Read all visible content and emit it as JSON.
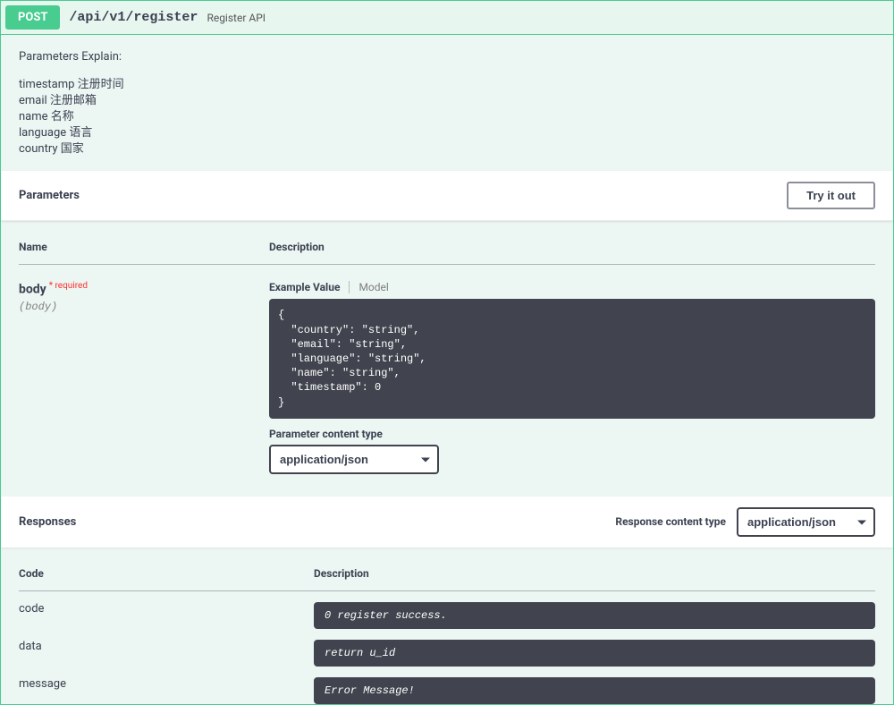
{
  "header": {
    "method": "POST",
    "path": "/api/v1/register",
    "summary": "Register API"
  },
  "description": {
    "title": "Parameters Explain:",
    "lines": [
      "timestamp 注册时间",
      "email 注册邮箱",
      "name 名称",
      "language 语言",
      "country 国家"
    ]
  },
  "parameters": {
    "section_label": "Parameters",
    "try_label": "Try it out",
    "header_name": "Name",
    "header_description": "Description",
    "body_name": "body",
    "required_label": "* required",
    "body_format": "(body)",
    "tab_example": "Example Value",
    "tab_model": "Model",
    "example_json": "{\n  \"country\": \"string\",\n  \"email\": \"string\",\n  \"language\": \"string\",\n  \"name\": \"string\",\n  \"timestamp\": 0\n}",
    "content_type_label": "Parameter content type",
    "content_type_value": "application/json"
  },
  "responses": {
    "section_label": "Responses",
    "response_ct_label": "Response content type",
    "response_ct_value": "application/json",
    "header_code": "Code",
    "header_description": "Description",
    "rows": [
      {
        "code": "code",
        "desc": "0 register success."
      },
      {
        "code": "data",
        "desc": "return u_id"
      },
      {
        "code": "message",
        "desc": "Error Message!"
      }
    ]
  }
}
